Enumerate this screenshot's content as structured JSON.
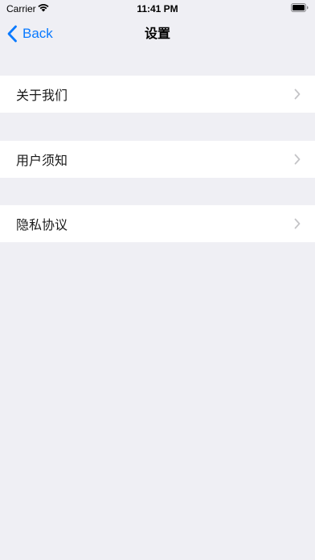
{
  "status_bar": {
    "carrier": "Carrier",
    "time": "11:41 PM",
    "icons": [
      "wifi-icon",
      "battery-icon"
    ]
  },
  "nav": {
    "back_label": "Back",
    "title": "设置",
    "accent_color": "#0a7aff"
  },
  "settings": {
    "items": [
      {
        "label": "关于我们",
        "icon": "chevron-right-icon"
      },
      {
        "label": "用户须知",
        "icon": "chevron-right-icon"
      },
      {
        "label": "隐私协议",
        "icon": "chevron-right-icon"
      }
    ]
  },
  "colors": {
    "background": "#efeff4",
    "row_background": "#ffffff",
    "chevron": "#c4c4c7"
  }
}
